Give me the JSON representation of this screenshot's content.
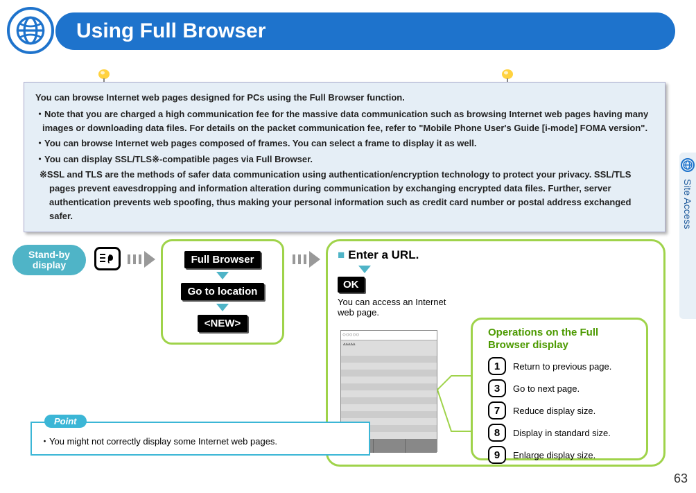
{
  "header": {
    "title": "Using Full Browser"
  },
  "side_tab": {
    "label": "Site Access"
  },
  "info": {
    "intro": "You can browse Internet web pages designed for PCs using the Full Browser function.",
    "bullets": [
      "Note that you are charged a high communication fee for the massive data communication such as browsing Internet web pages having many images or downloading data files. For details on the packet communication fee, refer to \"Mobile Phone User's Guide [i-mode] FOMA version\".",
      "You can browse Internet web pages composed of frames. You can select a frame to display it as well.",
      "You can display SSL/TLS※-compatible pages via Full Browser."
    ],
    "note": "※SSL and TLS are the methods of safer data communication using authentication/encryption technology to protect your privacy. SSL/TLS pages prevent eavesdropping and information alteration during communication by exchanging encrypted data files. Further, server authentication prevents web spoofing, thus making your personal information such as credit card number or postal address exchanged safer."
  },
  "standby": {
    "line1": "Stand-by",
    "line2": "display"
  },
  "steps": {
    "s1": "Full Browser",
    "s2": "Go to location",
    "s3": "<NEW>"
  },
  "url_panel": {
    "title": "Enter a URL.",
    "ok": "OK",
    "access_text": "You can access an Internet web page."
  },
  "ops": {
    "title": "Operations on the Full Browser display",
    "rows": [
      {
        "key": "1",
        "label": "Return to previous page."
      },
      {
        "key": "3",
        "label": "Go to next page."
      },
      {
        "key": "7",
        "label": "Reduce display size."
      },
      {
        "key": "8",
        "label": "Display in standard size."
      },
      {
        "key": "9",
        "label": "Enlarge display size."
      }
    ]
  },
  "point": {
    "label": "Point",
    "text": "You might not correctly display some Internet web pages."
  },
  "page_number": "63"
}
